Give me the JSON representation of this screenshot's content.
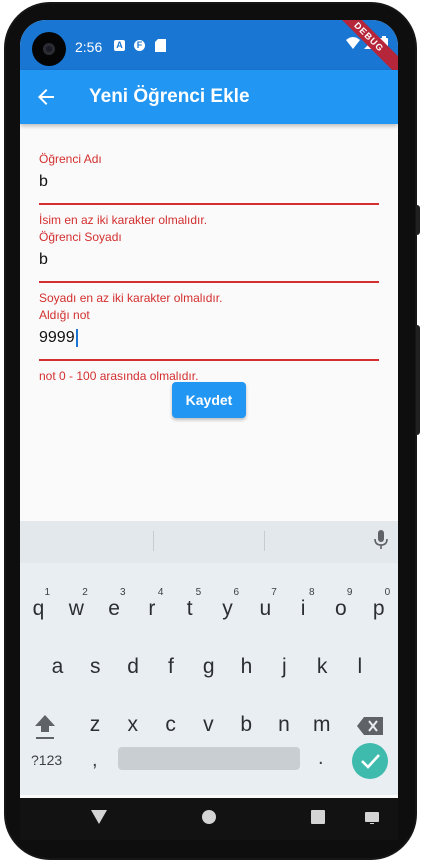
{
  "status_bar": {
    "time": "2:56",
    "notification_icons": [
      "A",
      "F",
      "sd-card-icon"
    ],
    "system_icons": [
      "wifi-icon",
      "signal-icon",
      "battery-icon"
    ],
    "debug_banner": "DEBUG"
  },
  "app_bar": {
    "title": "Yeni Öğrenci Ekle",
    "back_icon": "arrow-back-icon"
  },
  "form": {
    "fields": [
      {
        "label": "Öğrenci Adı",
        "value": "b",
        "error": "İsim en az iki karakter olmalıdır."
      },
      {
        "label": "Öğrenci Soyadı",
        "value": "b",
        "error": "Soyadı en az iki karakter olmalıdır."
      },
      {
        "label": "Aldığı not",
        "value": "9999",
        "error": "not 0 - 100 arasında olmalıdır."
      }
    ],
    "submit_label": "Kaydet"
  },
  "keyboard": {
    "row1": [
      "q",
      "w",
      "e",
      "r",
      "t",
      "y",
      "u",
      "i",
      "o",
      "p"
    ],
    "row1_numbers": [
      "1",
      "2",
      "3",
      "4",
      "5",
      "6",
      "7",
      "8",
      "9",
      "0"
    ],
    "row2": [
      "a",
      "s",
      "d",
      "f",
      "g",
      "h",
      "j",
      "k",
      "l"
    ],
    "row3": [
      "z",
      "x",
      "c",
      "v",
      "b",
      "n",
      "m"
    ],
    "symbols_label": "?123",
    "comma": ",",
    "period": ".",
    "shift_icon": "shift-icon",
    "backspace_icon": "backspace-icon",
    "enter_icon": "check-icon",
    "mic_icon": "mic-icon"
  },
  "nav_bar": {
    "icons": [
      "back-triangle-icon",
      "home-circle-icon",
      "recents-square-icon",
      "keyboard-switch-icon"
    ]
  },
  "colors": {
    "primary": "#2196f3",
    "status_bar": "#1976d2",
    "error": "#d32f2f",
    "keyboard_bg": "#e9eef2",
    "enter_key": "#3fbbad"
  }
}
